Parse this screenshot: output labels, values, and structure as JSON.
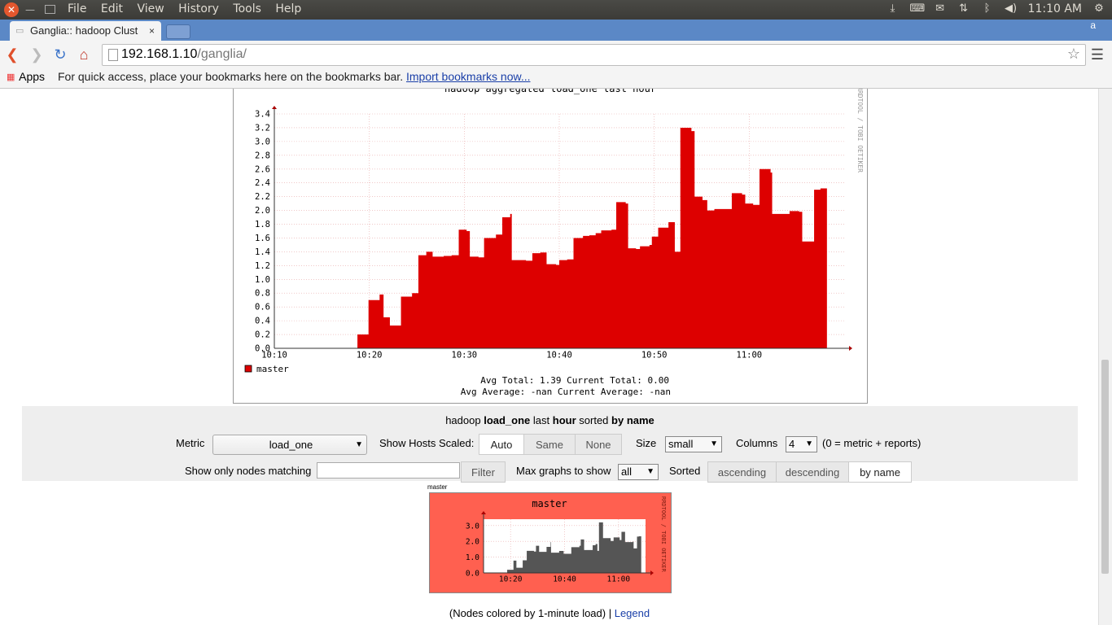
{
  "system_panel": {
    "menus": [
      "File",
      "Edit",
      "View",
      "History",
      "Tools",
      "Help"
    ],
    "clock": "11:10 AM",
    "tray_icons": [
      "download-icon",
      "keyboard-icon",
      "messaging-icon",
      "network-icon",
      "bluetooth-icon",
      "volume-icon",
      "settings-gear-icon"
    ]
  },
  "browser": {
    "tab_title": "Ganglia:: hadoop Clust",
    "tab_close": "×",
    "corner_letter": "a",
    "url_host": "192.168.1.10",
    "url_path": "/ganglia/",
    "bookmarks_apps": "Apps",
    "bookmarks_hint": "For quick access, place your bookmarks here on the bookmarks bar.",
    "bookmarks_link": "Import bookmarks now..."
  },
  "main_graph": {
    "title": "hadoop aggregated load_one last hour",
    "side_text": "RRDTOOL / TOBI OETIKER",
    "legend_series": "master",
    "stats_line1": "Avg Total:  1.39  Current Total:  0.00",
    "stats_line2": "Avg Average:  -nan  Current Average:  -nan"
  },
  "chart_data": [
    {
      "type": "area",
      "title": "hadoop aggregated load_one last hour",
      "xlabel": "",
      "ylabel": "",
      "ylim": [
        0,
        3.4
      ],
      "y_ticks": [
        "0.0",
        "0.2",
        "0.4",
        "0.6",
        "0.8",
        "1.0",
        "1.2",
        "1.4",
        "1.6",
        "1.8",
        "2.0",
        "2.2",
        "2.4",
        "2.6",
        "2.8",
        "3.0",
        "3.2",
        "3.4"
      ],
      "x_ticks": [
        "10:10",
        "10:20",
        "10:30",
        "10:40",
        "10:50",
        "11:00"
      ],
      "series": [
        {
          "name": "master",
          "color": "#dd0000",
          "points": [
            [
              "10:18:45",
              0.2
            ],
            [
              "10:19:55",
              0.7
            ],
            [
              "10:21:05",
              0.78
            ],
            [
              "10:21:30",
              0.45
            ],
            [
              "10:22:10",
              0.33
            ],
            [
              "10:23:20",
              0.75
            ],
            [
              "10:24:30",
              0.8
            ],
            [
              "10:25:10",
              1.35
            ],
            [
              "10:26:00",
              1.4
            ],
            [
              "10:26:40",
              1.33
            ],
            [
              "10:27:50",
              1.34
            ],
            [
              "10:28:40",
              1.35
            ],
            [
              "10:29:25",
              1.72
            ],
            [
              "10:30:15",
              1.7
            ],
            [
              "10:30:35",
              1.33
            ],
            [
              "10:31:30",
              1.32
            ],
            [
              "10:32:05",
              1.6
            ],
            [
              "10:33:20",
              1.65
            ],
            [
              "10:34:00",
              1.9
            ],
            [
              "10:34:50",
              1.95
            ],
            [
              "10:35:00",
              1.28
            ],
            [
              "10:36:30",
              1.27
            ],
            [
              "10:37:10",
              1.38
            ],
            [
              "10:38:00",
              1.39
            ],
            [
              "10:38:40",
              1.22
            ],
            [
              "10:39:40",
              1.21
            ],
            [
              "10:40:00",
              1.28
            ],
            [
              "10:40:50",
              1.29
            ],
            [
              "10:41:30",
              1.6
            ],
            [
              "10:42:30",
              1.63
            ],
            [
              "10:43:10",
              1.64
            ],
            [
              "10:43:50",
              1.67
            ],
            [
              "10:44:25",
              1.71
            ],
            [
              "10:45:30",
              1.72
            ],
            [
              "10:46:00",
              2.12
            ],
            [
              "10:47:00",
              2.1
            ],
            [
              "10:47:15",
              1.45
            ],
            [
              "10:48:05",
              1.44
            ],
            [
              "10:48:30",
              1.48
            ],
            [
              "10:49:30",
              1.5
            ],
            [
              "10:49:45",
              1.62
            ],
            [
              "10:50:25",
              1.75
            ],
            [
              "10:51:30",
              1.83
            ],
            [
              "10:52:10",
              1.4
            ],
            [
              "10:52:45",
              3.2
            ],
            [
              "10:53:55",
              3.15
            ],
            [
              "10:54:15",
              2.2
            ],
            [
              "10:55:05",
              2.15
            ],
            [
              "10:55:35",
              2.0
            ],
            [
              "10:56:20",
              2.02
            ],
            [
              "10:57:05",
              2.02
            ],
            [
              "10:58:10",
              2.25
            ],
            [
              "10:59:15",
              2.23
            ],
            [
              "10:59:35",
              2.1
            ],
            [
              "11:00:25",
              2.08
            ],
            [
              "11:01:05",
              2.6
            ],
            [
              "11:02:15",
              2.55
            ],
            [
              "11:02:25",
              1.95
            ],
            [
              "11:03:50",
              1.95
            ],
            [
              "11:04:15",
              1.99
            ],
            [
              "11:05:15",
              1.98
            ],
            [
              "11:05:35",
              1.55
            ],
            [
              "11:06:20",
              1.55
            ],
            [
              "11:06:50",
              2.3
            ],
            [
              "11:07:30",
              2.32
            ]
          ]
        }
      ]
    },
    {
      "type": "area",
      "title": "master",
      "ylim": [
        0,
        3.4
      ],
      "y_ticks": [
        "0.0",
        "1.0",
        "2.0",
        "3.0"
      ],
      "x_ticks": [
        "10:20",
        "10:40",
        "11:00"
      ],
      "series": [
        {
          "name": "master",
          "color": "#555555",
          "points": [
            [
              "10:18:45",
              0.2
            ],
            [
              "10:21:05",
              0.78
            ],
            [
              "10:22:10",
              0.33
            ],
            [
              "10:24:30",
              0.8
            ],
            [
              "10:26:00",
              1.4
            ],
            [
              "10:28:40",
              1.35
            ],
            [
              "10:29:25",
              1.72
            ],
            [
              "10:30:35",
              1.33
            ],
            [
              "10:33:20",
              1.65
            ],
            [
              "10:34:50",
              1.95
            ],
            [
              "10:35:00",
              1.28
            ],
            [
              "10:38:00",
              1.39
            ],
            [
              "10:39:40",
              1.21
            ],
            [
              "10:42:30",
              1.63
            ],
            [
              "10:45:30",
              1.72
            ],
            [
              "10:46:00",
              2.12
            ],
            [
              "10:47:15",
              1.45
            ],
            [
              "10:50:25",
              1.75
            ],
            [
              "10:51:30",
              1.83
            ],
            [
              "10:52:10",
              1.4
            ],
            [
              "10:52:45",
              3.2
            ],
            [
              "10:54:15",
              2.2
            ],
            [
              "10:57:05",
              2.02
            ],
            [
              "10:58:10",
              2.25
            ],
            [
              "11:00:25",
              2.08
            ],
            [
              "11:01:05",
              2.6
            ],
            [
              "11:02:25",
              1.95
            ],
            [
              "11:05:15",
              1.98
            ],
            [
              "11:05:35",
              1.55
            ],
            [
              "11:06:50",
              2.3
            ],
            [
              "11:07:30",
              2.32
            ]
          ]
        }
      ]
    }
  ],
  "controls": {
    "header_host": "hadoop",
    "header_metric": "load_one",
    "header_last": "last",
    "header_range": "hour",
    "header_sorted": "sorted",
    "header_sortby": "by name",
    "metric_label": "Metric",
    "metric_value": "load_one",
    "scaled_label": "Show Hosts Scaled:",
    "scaled_options": [
      "Auto",
      "Same",
      "None"
    ],
    "size_label": "Size",
    "size_value": "small",
    "columns_label": "Columns",
    "columns_value": "4",
    "columns_note": "(0 = metric + reports)",
    "filter_label": "Show only nodes matching",
    "filter_value": "",
    "filter_button": "Filter",
    "maxgraphs_label": "Max graphs to show",
    "maxgraphs_value": "all",
    "sorted_label": "Sorted",
    "sort_options": [
      "ascending",
      "descending",
      "by name"
    ]
  },
  "thumbnail": {
    "label": "master",
    "title": "master",
    "side_text": "RRDTOOL / TOBI OETIKER",
    "bg_color": "#ff6050"
  },
  "footer": {
    "text": "(Nodes colored by 1-minute load) |",
    "legend_link": "Legend"
  }
}
